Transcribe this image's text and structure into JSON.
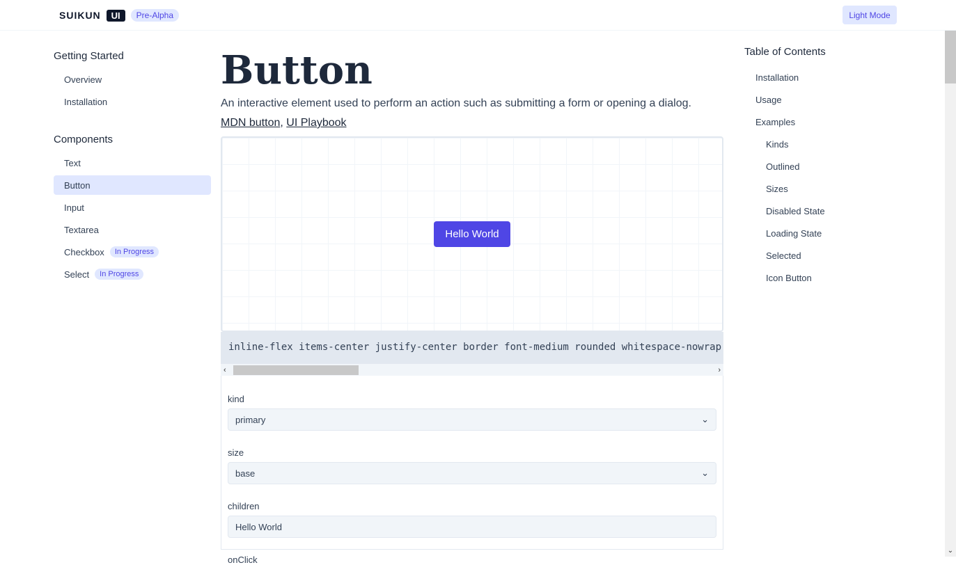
{
  "header": {
    "brand": "SUIKUN",
    "brand_tag": "UI",
    "stage_badge": "Pre-Alpha",
    "theme_button": "Light Mode"
  },
  "sidebar": {
    "sections": [
      {
        "title": "Getting Started",
        "items": [
          {
            "label": "Overview"
          },
          {
            "label": "Installation"
          }
        ]
      },
      {
        "title": "Components",
        "items": [
          {
            "label": "Text"
          },
          {
            "label": "Button",
            "active": true
          },
          {
            "label": "Input"
          },
          {
            "label": "Textarea"
          },
          {
            "label": "Checkbox",
            "badge": "In Progress"
          },
          {
            "label": "Select",
            "badge": "In Progress"
          }
        ]
      }
    ]
  },
  "main": {
    "title": "Button",
    "description": "An interactive element used to perform an action such as submitting a form or opening a dialog.",
    "links": [
      {
        "label": "MDN button"
      },
      {
        "label": "UI Playbook"
      }
    ],
    "link_separator": ", ",
    "preview_button": "Hello World",
    "class_string": "inline-flex items-center justify-center border font-medium rounded whitespace-nowrap t",
    "props": [
      {
        "label": "kind",
        "value": "primary",
        "type": "select"
      },
      {
        "label": "size",
        "value": "base",
        "type": "select"
      },
      {
        "label": "children",
        "value": "Hello World",
        "type": "input"
      },
      {
        "label": "onClick",
        "value": "",
        "type": "label"
      }
    ]
  },
  "toc": {
    "title": "Table of Contents",
    "items": [
      {
        "label": "Installation",
        "level": 1
      },
      {
        "label": "Usage",
        "level": 1
      },
      {
        "label": "Examples",
        "level": 1
      },
      {
        "label": "Kinds",
        "level": 2
      },
      {
        "label": "Outlined",
        "level": 2
      },
      {
        "label": "Sizes",
        "level": 2
      },
      {
        "label": "Disabled State",
        "level": 2
      },
      {
        "label": "Loading State",
        "level": 2
      },
      {
        "label": "Selected",
        "level": 2
      },
      {
        "label": "Icon Button",
        "level": 2
      }
    ]
  },
  "icons": {
    "chevron": "⌄",
    "scroll_left": "‹",
    "scroll_right": "›",
    "scroll_down": "⌄"
  }
}
